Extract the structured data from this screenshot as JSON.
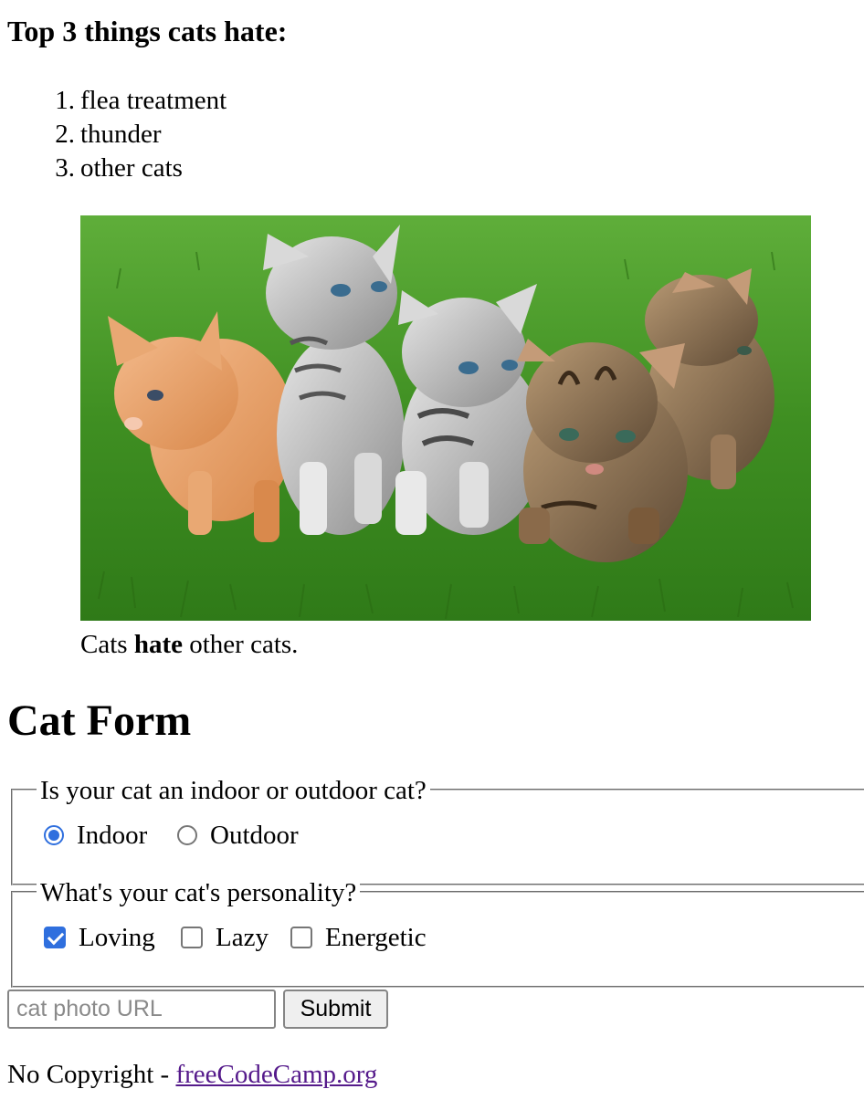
{
  "top_things": {
    "heading": "Top 3 things cats hate:",
    "items": [
      {
        "number": "1.",
        "label": "flea treatment"
      },
      {
        "number": "2.",
        "label": "thunder"
      },
      {
        "number": "3.",
        "label": "other cats"
      }
    ]
  },
  "figure": {
    "image_subject": "five kittens on green grass",
    "caption": {
      "before": "Cats ",
      "bold": "hate",
      "after": " other cats."
    }
  },
  "form": {
    "heading": "Cat Form",
    "location": {
      "legend": "Is your cat an indoor or outdoor cat?",
      "options": [
        {
          "label": "Indoor",
          "checked": true
        },
        {
          "label": "Outdoor",
          "checked": false
        }
      ]
    },
    "personality": {
      "legend": "What's your cat's personality?",
      "options": [
        {
          "label": "Loving",
          "checked": true
        },
        {
          "label": "Lazy",
          "checked": false
        },
        {
          "label": "Energetic",
          "checked": false
        }
      ]
    },
    "url_input": {
      "placeholder": "cat photo URL",
      "value": ""
    },
    "submit_label": "Submit"
  },
  "footer": {
    "text": "No Copyright - ",
    "link_text": "freeCodeCamp.org"
  },
  "colors": {
    "accent": "#2f6fde",
    "visited_link": "#551a8b",
    "grass": "#3f8f22"
  }
}
